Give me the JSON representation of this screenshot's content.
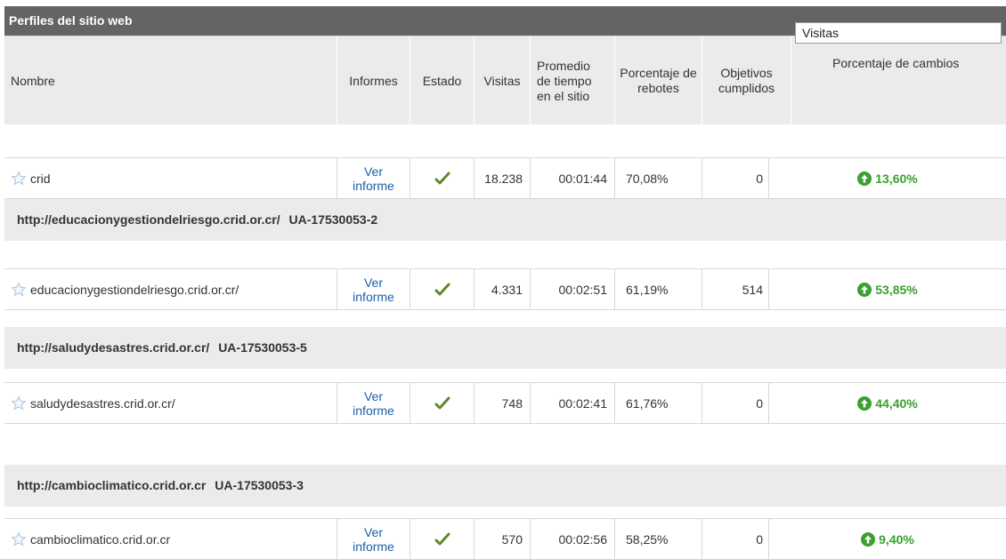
{
  "title": "Perfiles del sitio web",
  "headers": {
    "nombre": "Nombre",
    "informes": "Informes",
    "estado": "Estado",
    "visitas": "Visitas",
    "promedio": "Promedio de tiempo en el sitio",
    "rebotes": "Porcentaje de rebotes",
    "objetivos": "Objetivos cumplidos",
    "metric_select": "Visitas",
    "cambios": "Porcentaje de cambios"
  },
  "report_link_line1": "Ver",
  "report_link_line2": "informe",
  "rows": [
    {
      "name": "crid",
      "visitas": "18.238",
      "tiempo": "00:01:44",
      "rebotes": "70,08%",
      "objetivos": "0",
      "cambio": "13,60%"
    },
    {
      "name": "educacionygestiondelriesgo.crid.or.cr/",
      "visitas": "4.331",
      "tiempo": "00:02:51",
      "rebotes": "61,19%",
      "objetivos": "514",
      "cambio": "53,85%"
    },
    {
      "name": "saludydesastres.crid.or.cr/",
      "visitas": "748",
      "tiempo": "00:02:41",
      "rebotes": "61,76%",
      "objetivos": "0",
      "cambio": "44,40%"
    },
    {
      "name": "cambioclimatico.crid.or.cr",
      "visitas": "570",
      "tiempo": "00:02:56",
      "rebotes": "58,25%",
      "objetivos": "0",
      "cambio": "9,40%"
    }
  ],
  "groups": [
    {
      "url": "http://educacionygestiondelriesgo.crid.or.cr/",
      "id": "UA-17530053-2"
    },
    {
      "url": "http://saludydesastres.crid.or.cr/",
      "id": "UA-17530053-5"
    },
    {
      "url": "http://cambioclimatico.crid.or.cr",
      "id": "UA-17530053-3"
    }
  ],
  "colors": {
    "header_bar": "#646464",
    "positive": "#3aa02f",
    "link": "#1a5fa8"
  },
  "icons": {
    "favorite": "star-icon",
    "status": "checkmark-icon",
    "trend": "arrow-up-circle-icon"
  }
}
